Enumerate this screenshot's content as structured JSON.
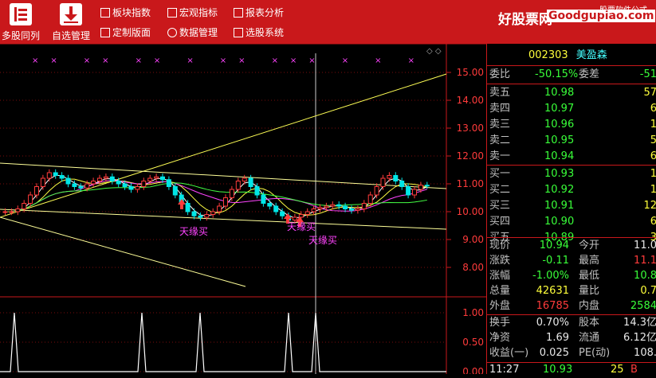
{
  "toolbar": {
    "multi_stock": "多股同列",
    "watchlist": "自选管理",
    "sector_index": "板块指数",
    "macro": "宏观指标",
    "report": "报表分析",
    "custom_layout": "定制版面",
    "data_mgmt": "数据管理",
    "stock_picker": "选股系统"
  },
  "logo": {
    "brand": "好股票网",
    "site": "Goodgupiao.com",
    "tag": "股票软件公式"
  },
  "chart": {
    "price_ticks": [
      "15.00",
      "14.00",
      "13.00",
      "12.00",
      "11.00",
      "10.00",
      "9.00",
      "8.00"
    ],
    "indicator_ticks": [
      "1.00",
      "0.50",
      "0.00"
    ],
    "labels": [
      "天缘买",
      "天缘买",
      "天缘买"
    ],
    "top_markers": "××  ×× ×× ×  ×× ××× ×  × ×"
  },
  "quote": {
    "code": "002303",
    "name": "美盈森",
    "weibi_label": "委比",
    "weibi": "-50.15%",
    "weicha_label": "委差",
    "weicha": "-51",
    "asks": [
      {
        "label": "卖五",
        "price": "10.98",
        "vol": "57"
      },
      {
        "label": "卖四",
        "price": "10.97",
        "vol": "6"
      },
      {
        "label": "卖三",
        "price": "10.96",
        "vol": "1"
      },
      {
        "label": "卖二",
        "price": "10.95",
        "vol": "5"
      },
      {
        "label": "卖一",
        "price": "10.94",
        "vol": "6"
      }
    ],
    "bids": [
      {
        "label": "买一",
        "price": "10.93",
        "vol": "1"
      },
      {
        "label": "买二",
        "price": "10.92",
        "vol": "1"
      },
      {
        "label": "买三",
        "price": "10.91",
        "vol": "12"
      },
      {
        "label": "买四",
        "price": "10.90",
        "vol": "6"
      },
      {
        "label": "买五",
        "price": "10.89",
        "vol": "3"
      }
    ],
    "stats": [
      {
        "l1": "现价",
        "v1": "10.94",
        "c1": "green",
        "l2": "今开",
        "v2": "11.0",
        "c2": "white"
      },
      {
        "l1": "涨跌",
        "v1": "-0.11",
        "c1": "green",
        "l2": "最高",
        "v2": "11.1",
        "c2": "red"
      },
      {
        "l1": "涨幅",
        "v1": "-1.00%",
        "c1": "green",
        "l2": "最低",
        "v2": "10.8",
        "c2": "green"
      },
      {
        "l1": "总量",
        "v1": "42631",
        "c1": "yellow",
        "l2": "量比",
        "v2": "0.7",
        "c2": "yellow"
      },
      {
        "l1": "外盘",
        "v1": "16785",
        "c1": "red",
        "l2": "内盘",
        "v2": "2584",
        "c2": "green"
      }
    ],
    "stats2": [
      {
        "l1": "换手",
        "v1": "0.70%",
        "l2": "股本",
        "v2": "14.3亿"
      },
      {
        "l1": "净资",
        "v1": "1.69",
        "l2": "流通",
        "v2": "6.12亿"
      },
      {
        "l1": "收益(一)",
        "v1": "0.025",
        "l2": "PE(动)",
        "v2": "108."
      }
    ],
    "tick": {
      "time": "11:27",
      "price": "10.93",
      "vol": "25",
      "side": "B"
    }
  },
  "colors": {
    "brand_red": "#c9181b",
    "up": "#ff3b3b",
    "down": "#39ff39"
  }
}
